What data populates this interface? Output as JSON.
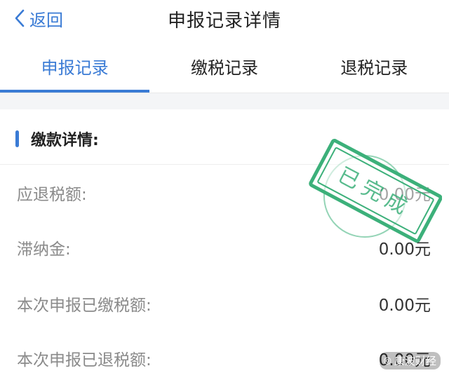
{
  "header": {
    "back_label": "返回",
    "title": "申报记录详情"
  },
  "tabs": [
    {
      "label": "申报记录",
      "active": true
    },
    {
      "label": "缴税记录",
      "active": false
    },
    {
      "label": "退税记录",
      "active": false
    }
  ],
  "section": {
    "title": "缴款详情:"
  },
  "rows": [
    {
      "label": "应退税额:",
      "value": "0.00元"
    },
    {
      "label": "滞纳金:",
      "value": "0.00元"
    },
    {
      "label": "本次申报已缴税额:",
      "value": "0.00元"
    },
    {
      "label": "本次申报已退税额:",
      "value": "0.00元"
    }
  ],
  "stamp": {
    "text": "已完成",
    "color": "#3cb07a"
  },
  "watermark": {
    "text": "康波财经"
  },
  "colors": {
    "accent": "#3a7bd5",
    "label": "#8a8a8a",
    "background_gap": "#f4f5f7"
  }
}
